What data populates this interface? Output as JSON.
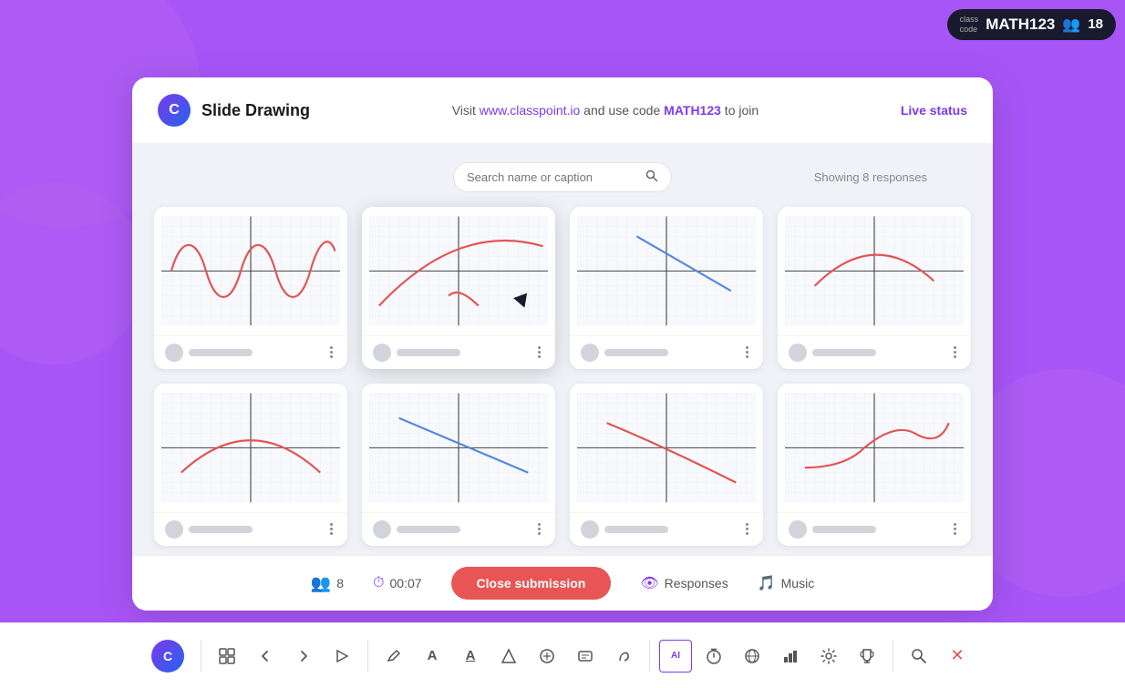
{
  "topbar": {
    "label": "class\ncode",
    "code": "MATH123",
    "participants": "18"
  },
  "header": {
    "app_title": "Slide Drawing",
    "visit_text": "Visit ",
    "url": "www.classpoint.io",
    "use_code_text": " and use code ",
    "class_code": "MATH123",
    "to_join": " to join",
    "live_status": "Live status"
  },
  "search": {
    "placeholder": "Search name or caption",
    "showing": "Showing 8 responses"
  },
  "cards": [
    {
      "id": 1,
      "graph_type": "sine_wave",
      "active": false
    },
    {
      "id": 2,
      "graph_type": "parabola_down",
      "active": true
    },
    {
      "id": 3,
      "graph_type": "line_negative",
      "active": false
    },
    {
      "id": 4,
      "graph_type": "arch",
      "active": false
    },
    {
      "id": 5,
      "graph_type": "half_parabola",
      "active": false
    },
    {
      "id": 6,
      "graph_type": "line_negative_blue",
      "active": false
    },
    {
      "id": 7,
      "graph_type": "line_curve_neg",
      "active": false
    },
    {
      "id": 8,
      "graph_type": "s_curve",
      "active": false
    }
  ],
  "action_bar": {
    "participants": "8",
    "timer": "00:07",
    "close_submission": "Close submission",
    "responses": "Responses",
    "music": "Music"
  },
  "toolbar": {
    "items": [
      "⊞",
      "←",
      "→",
      "▷",
      "✏",
      "A",
      "A̲",
      "◇",
      "⊕",
      "AI",
      "⏰",
      "🌐",
      "📊",
      "⚙",
      "🏆",
      "🔍",
      "✖"
    ]
  },
  "colors": {
    "purple": "#7c3aed",
    "red": "#e85555",
    "accent_purple": "#a855f7",
    "graph_red": "#e05555",
    "graph_blue": "#5588dd"
  }
}
